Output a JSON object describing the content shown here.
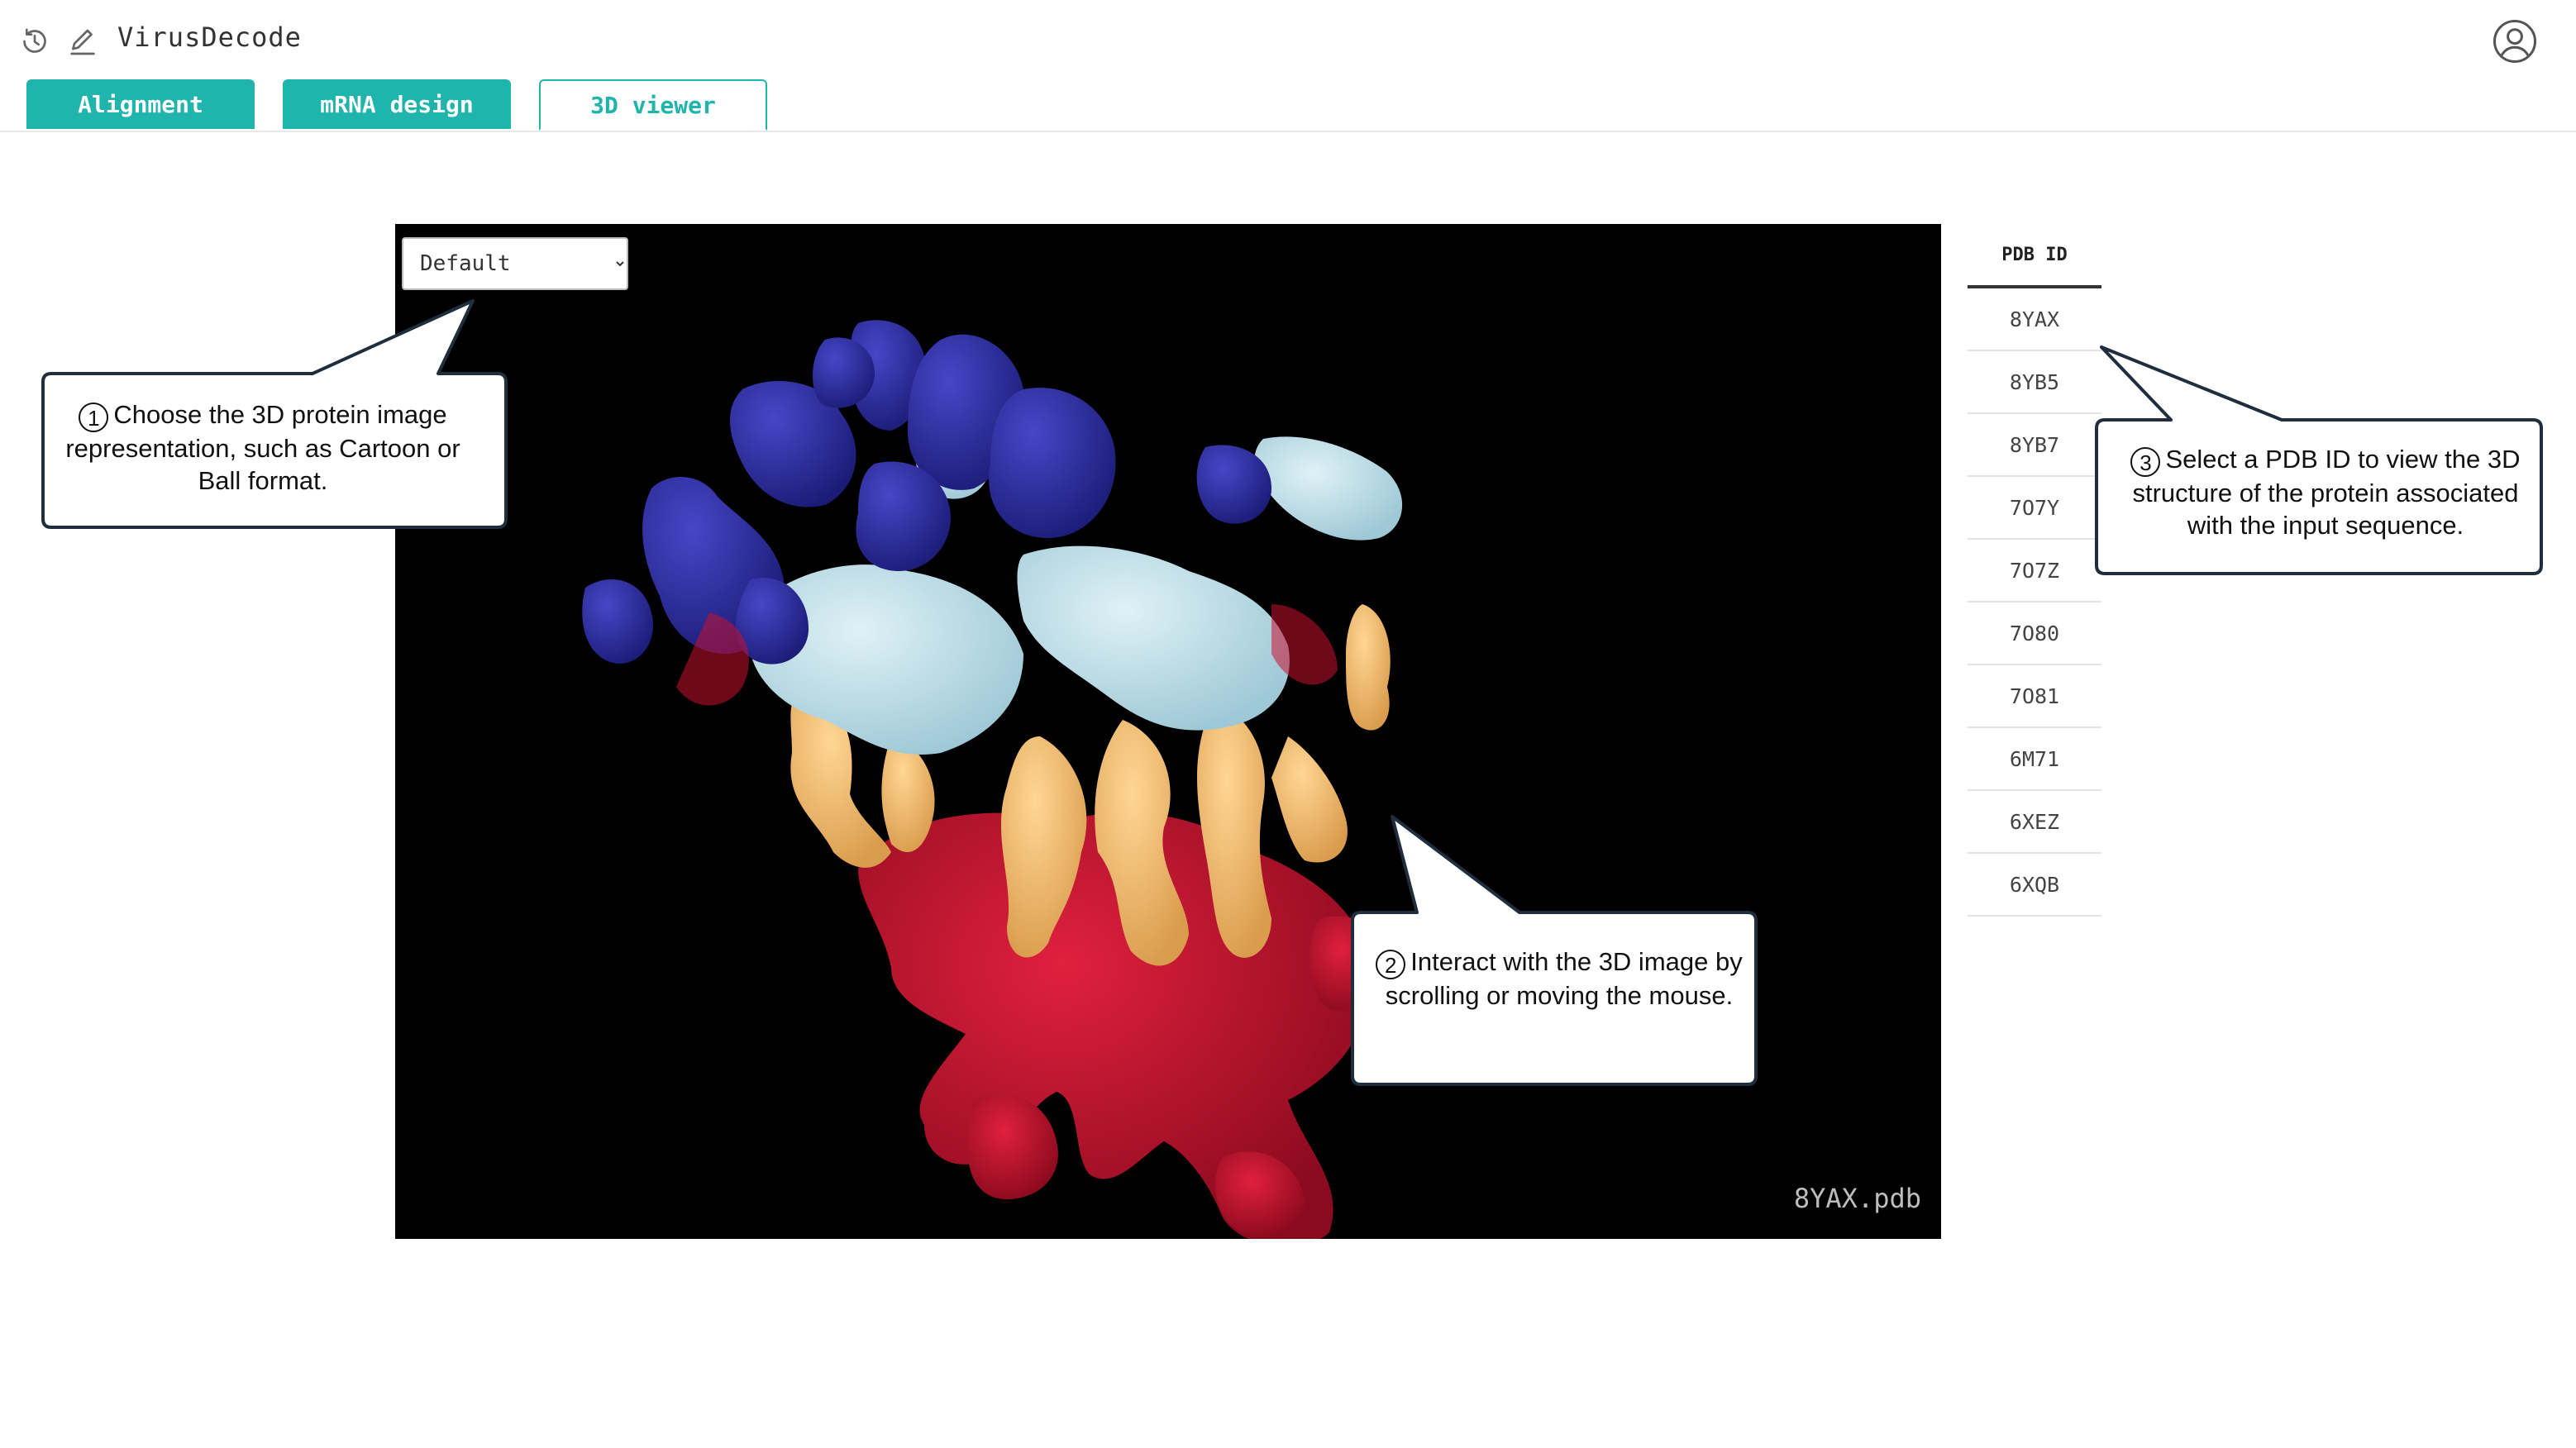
{
  "header": {
    "app_title": "VirusDecode",
    "icons": [
      "history-icon",
      "edit-icon",
      "user-account-icon"
    ]
  },
  "tabs": [
    {
      "label": "Alignment",
      "active": false
    },
    {
      "label": "mRNA design",
      "active": false
    },
    {
      "label": "3D viewer",
      "active": true
    }
  ],
  "viewer": {
    "representation_select": {
      "selected": "Default"
    },
    "file_label": "8YAX.pdb"
  },
  "pdb_table": {
    "header": "PDB ID",
    "rows": [
      "8YAX",
      "8YB5",
      "8YB7",
      "7O7Y",
      "7O7Z",
      "7O80",
      "7O81",
      "6M71",
      "6XEZ",
      "6XQB"
    ]
  },
  "callouts": [
    {
      "number": "1",
      "text": "Choose the 3D protein image representation, such as Cartoon or Ball format."
    },
    {
      "number": "2",
      "text": "Interact with the 3D image by scrolling or moving the mouse."
    },
    {
      "number": "3",
      "text": "Select a PDB ID to view the 3D structure of the protein associated with the input sequence."
    }
  ],
  "colors": {
    "accent": "#1fb5ac",
    "protein_blue": "#2a2aa0",
    "protein_light": "#bfe0ea",
    "protein_red": "#c8102e",
    "protein_tan": "#f3c27a"
  }
}
